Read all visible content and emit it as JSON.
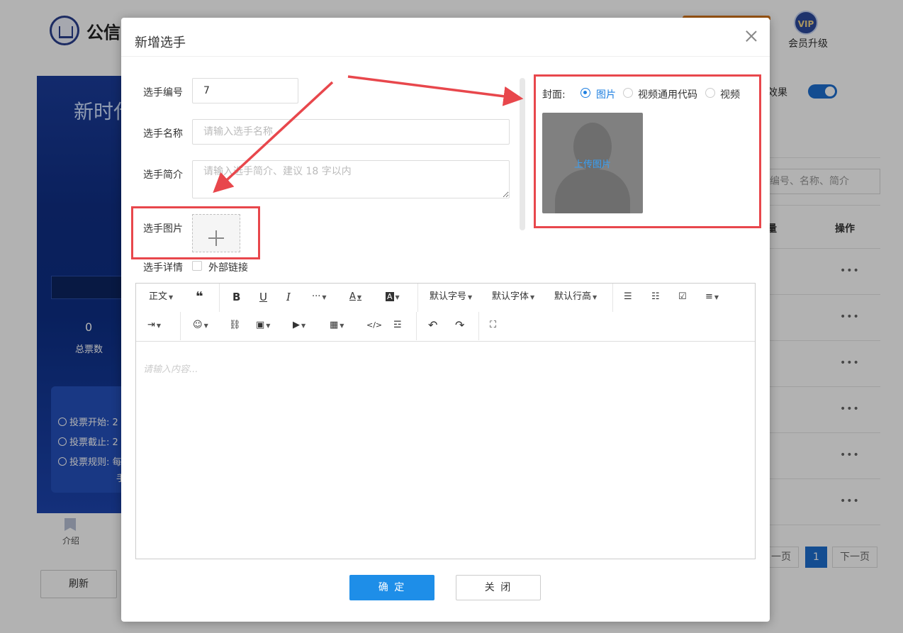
{
  "background": {
    "brand": "公信",
    "vip_badge": "VIP",
    "vip_label": "会员升级",
    "banner_title": "新时代",
    "total_votes_value": "0",
    "total_votes_label": "总票数",
    "vote_start": "投票开始: 2",
    "vote_end": "投票截止: 2",
    "vote_rules": "投票规则: 每",
    "vote_rules_cont": "手",
    "intro_label": "介绍",
    "refresh_button": "刷新",
    "effect_label": "效果",
    "search_placeholder": "编号、名称、简介",
    "col_count": "量",
    "col_actions": "操作",
    "row_action": "•••",
    "pagination": {
      "prev": "一页",
      "current": "1",
      "next": "下一页"
    }
  },
  "modal": {
    "title": "新增选手",
    "form": {
      "number_label": "选手编号",
      "number_value": "7",
      "name_label": "选手名称",
      "name_placeholder": "请输入选手名称",
      "intro_label": "选手简介",
      "intro_placeholder": "请输入选手简介、建议 18 字以内",
      "image_label": "选手图片",
      "detail_label": "选手详情",
      "external_link_label": "外部链接"
    },
    "cover": {
      "label": "封面:",
      "options": [
        "图片",
        "视频通用代码",
        "视频"
      ],
      "selected": "图片",
      "upload_text": "上传图片"
    },
    "editor": {
      "toolbar": {
        "paragraph": "正文",
        "font_size": "默认字号",
        "font_family": "默认字体",
        "line_height": "默认行高"
      },
      "placeholder": "请输入内容..."
    },
    "confirm_button": "确 定",
    "close_button": "关 闭"
  },
  "colors": {
    "primary": "#1e8ee8",
    "annotation": "#e8474c",
    "overlay": "rgba(0,0,0,0.3)"
  }
}
